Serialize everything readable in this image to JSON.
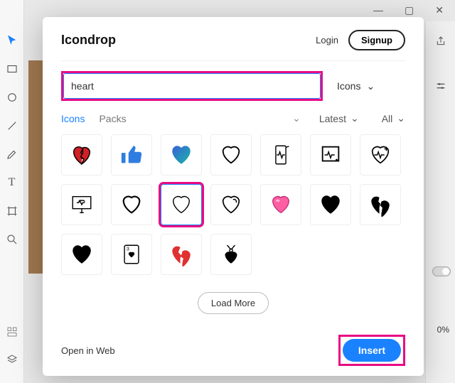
{
  "window_controls": {
    "min": "—",
    "max": "▢",
    "close": "✕"
  },
  "dialog": {
    "title": "Icondrop",
    "login": "Login",
    "signup": "Signup",
    "search_value": "heart",
    "type_dropdown": "Icons",
    "tabs": {
      "icons": "Icons",
      "packs": "Packs"
    },
    "sort_dropdown": "Latest",
    "filter_dropdown": "All",
    "load_more": "Load More",
    "open_web": "Open in Web",
    "insert": "Insert"
  },
  "icons": [
    {
      "name": "broken-heart-red"
    },
    {
      "name": "thumbs-up-blue"
    },
    {
      "name": "heart-gradient"
    },
    {
      "name": "heart-outline"
    },
    {
      "name": "phone-heartbeat"
    },
    {
      "name": "monitor-heartbeat"
    },
    {
      "name": "heart-plus-outline"
    },
    {
      "name": "desktop-heartbeat"
    },
    {
      "name": "heart-outline-thin"
    },
    {
      "name": "heart-outline-selected"
    },
    {
      "name": "heart-script-outline"
    },
    {
      "name": "heart-pink-glossy"
    },
    {
      "name": "heart-solid-black"
    },
    {
      "name": "broken-heart-black"
    },
    {
      "name": "heart-solid-black-2"
    },
    {
      "name": "playing-card-hearts"
    },
    {
      "name": "broken-heart-red-2"
    },
    {
      "name": "heart-pendant"
    }
  ],
  "right_panel": {
    "opacity": "0%"
  }
}
